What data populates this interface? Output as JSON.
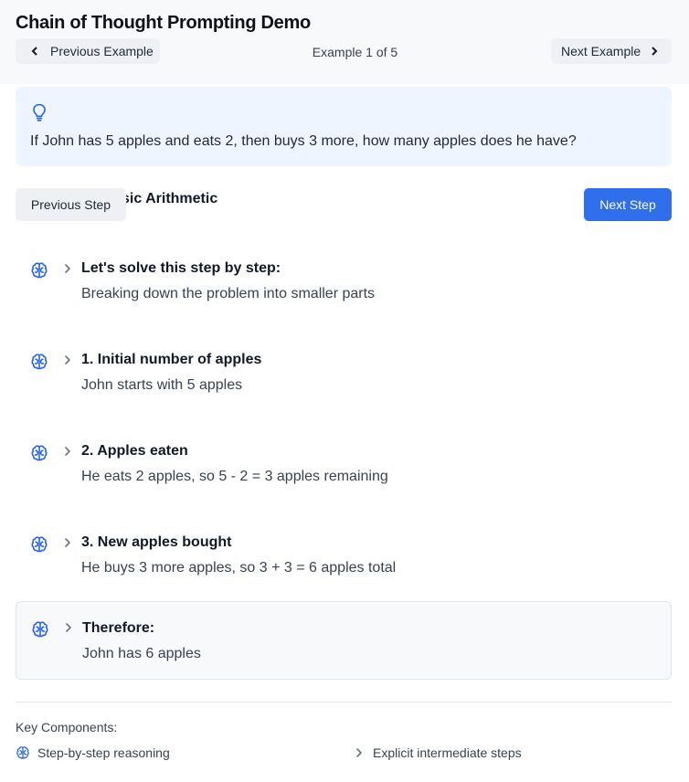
{
  "header": {
    "title": "Chain of Thought Prompting Demo",
    "prev_example_label": "Previous Example",
    "next_example_label": "Next Example",
    "counter": "Example 1 of 5"
  },
  "problem": {
    "icon": "lightbulb-icon",
    "category": "Math - Basic Arithmetic",
    "question": "If John has 5 apples and eats 2, then buys 3 more, how many apples does he have?"
  },
  "controls": {
    "prev_step_label": "Previous Step",
    "next_step_label": "Next Step",
    "next_step_color": "#2f6fec"
  },
  "steps": [
    {
      "title": "Let's solve this step by step:",
      "desc": "Breaking down the problem into smaller parts"
    },
    {
      "title": "1. Initial number of apples",
      "desc": "John starts with 5 apples"
    },
    {
      "title": "2. Apples eaten",
      "desc": "He eats 2 apples, so 5 - 2 = 3 apples remaining"
    },
    {
      "title": "3. New apples bought",
      "desc": "He buys 3 more apples, so 3 + 3 = 6 apples total"
    },
    {
      "title": "Therefore:",
      "desc": "John has 6 apples"
    }
  ],
  "key_components": {
    "title": "Key Components:",
    "items": [
      {
        "icon": "brain-icon",
        "label": "Step-by-step reasoning"
      },
      {
        "icon": "chevron-right-icon",
        "label": "Explicit intermediate steps"
      }
    ]
  },
  "colors": {
    "accent": "#2563eb",
    "problem_bg": "#eef5ff"
  }
}
